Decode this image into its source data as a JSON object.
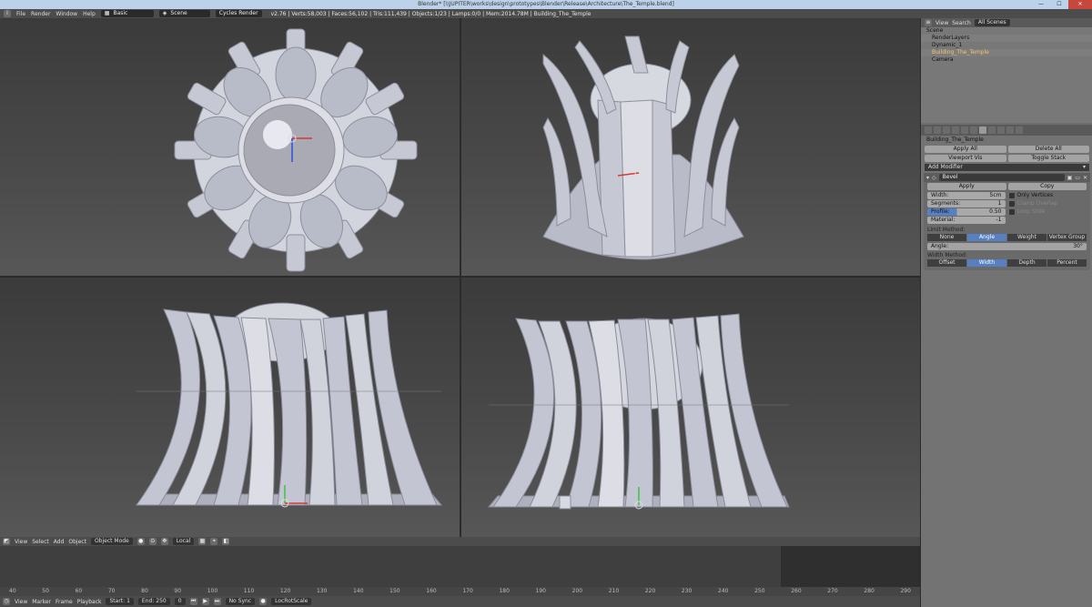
{
  "window": {
    "title": "Blender* [\\\\JUPITER\\works\\design\\prototypes\\Blender\\Release\\Architecture\\The_Temple.blend]",
    "min": "—",
    "max": "☐",
    "close": "✕"
  },
  "topbar": {
    "menus": [
      "File",
      "Render",
      "Window",
      "Help"
    ],
    "layout": "Basic",
    "scene": "Scene",
    "engine": "Cycles Render",
    "stats": "v2.76 | Verts:58,003 | Faces:56,102 | Tris:111,439 | Objects:1/23 | Lamps:0/0 | Mem:2014.78M | Building_The_Temple"
  },
  "viewport_header": {
    "menus": [
      "View",
      "Select",
      "Add",
      "Object"
    ],
    "mode": "Object Mode",
    "pivot": "Local"
  },
  "timeline": {
    "ticks": [
      "40",
      "50",
      "60",
      "70",
      "80",
      "90",
      "100",
      "110",
      "120",
      "130",
      "140",
      "150",
      "160",
      "170",
      "180",
      "190",
      "200",
      "210",
      "220",
      "230",
      "240",
      "250",
      "260",
      "270",
      "280",
      "290"
    ],
    "menus": [
      "View",
      "Marker",
      "Frame",
      "Playback"
    ],
    "start_label": "Start:",
    "start_value": "1",
    "end_label": "End:",
    "end_value": "250",
    "current_frame": "0",
    "keying_set": "No Sync",
    "sync": "LocRotScale"
  },
  "outliner": {
    "header": {
      "view": "View",
      "search": "Search",
      "filter": "All Scenes"
    },
    "items": [
      "Scene",
      "RenderLayers",
      "Dynamic_1",
      "Building_The_Temple",
      "Camera"
    ],
    "selected_index": 3
  },
  "properties": {
    "object_name": "Building_The_Temple",
    "buttons": {
      "apply_all": "Apply All",
      "delete_all": "Delete All",
      "viewport_vis": "Viewport Vis",
      "toggle_stack": "Toggle Stack"
    },
    "add_modifier": "Add Modifier",
    "modifier": {
      "name": "Bevel",
      "apply": "Apply",
      "copy": "Copy",
      "width_label": "Width:",
      "width_value": "5cm",
      "segments_label": "Segments:",
      "segments_value": "1",
      "profile_label": "Profile:",
      "profile_value": "0.50",
      "profile_fraction": 0.38,
      "material_label": "Material:",
      "material_value": "-1",
      "only_vertices": "Only Vertices",
      "clamp_overlap": "Clamp Overlap",
      "loop_slide": "Loop Slide",
      "limit_method_label": "Limit Method:",
      "limit_methods": [
        "None",
        "Angle",
        "Weight",
        "Vertex Group"
      ],
      "limit_active": 1,
      "angle_label": "Angle:",
      "angle_value": "30°",
      "width_method_label": "Width Method:",
      "width_methods": [
        "Offset",
        "Width",
        "Depth",
        "Percent"
      ],
      "width_active": 1
    }
  },
  "colors": {
    "accent": "#5680c2",
    "selection": "#f5c46a",
    "mesh": "#c8cbd6",
    "background": "#3d3d3d"
  }
}
